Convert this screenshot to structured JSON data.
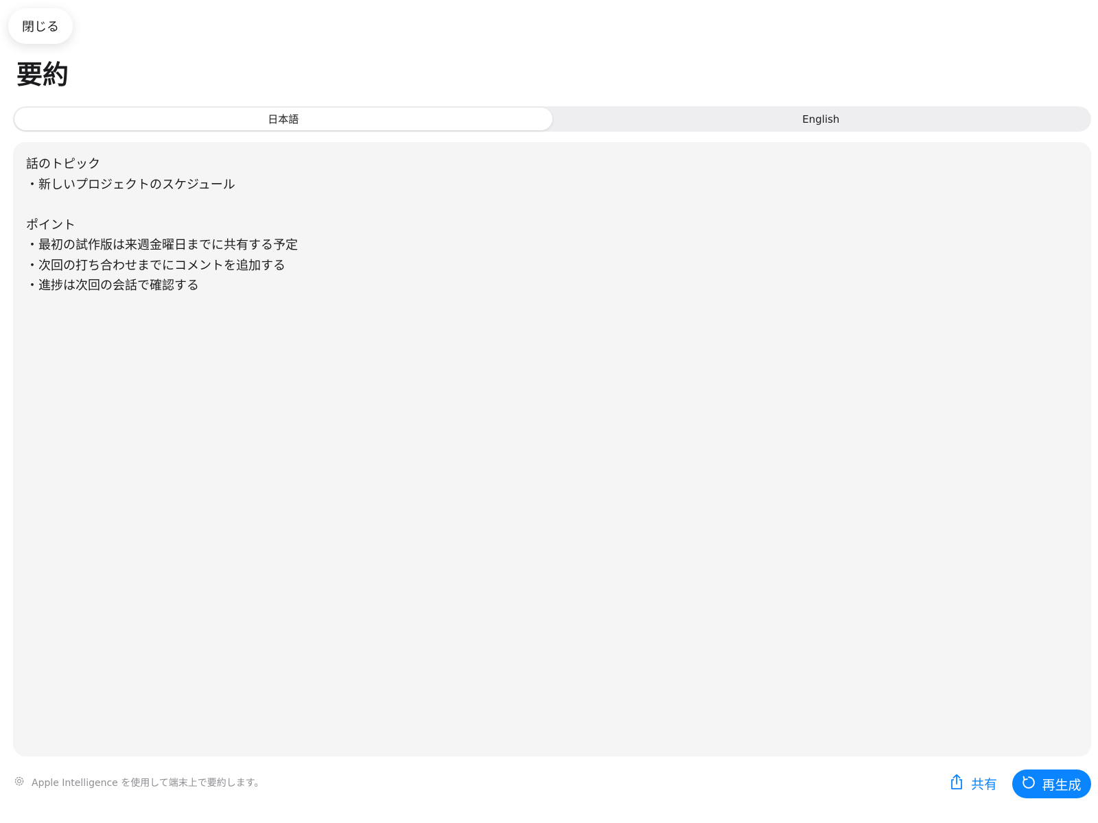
{
  "header": {
    "close_label": "閉じる",
    "title": "要約"
  },
  "language_tabs": [
    {
      "label": "日本語",
      "selected": true
    },
    {
      "label": "English",
      "selected": false
    }
  ],
  "summary": {
    "lines": [
      "話のトピック",
      "・新しいプロジェクトのスケジュール",
      "",
      "ポイント",
      "・最初の試作版は来週金曜日までに共有する予定",
      "・次回の打ち合わせまでにコメントを追加する",
      "・進捗は次回の会話で確認する"
    ]
  },
  "footer": {
    "note_icon": "apple-intelligence-icon",
    "note": "Apple Intelligence を使用して端末上で要約します。",
    "share_icon": "share-icon",
    "share_label": "共有",
    "regenerate_icon": "refresh-icon",
    "regenerate_label": "再生成"
  },
  "colors": {
    "accent": "#0a84ff",
    "panel": "#f5f5f5",
    "segment_track": "#eeeef0"
  }
}
